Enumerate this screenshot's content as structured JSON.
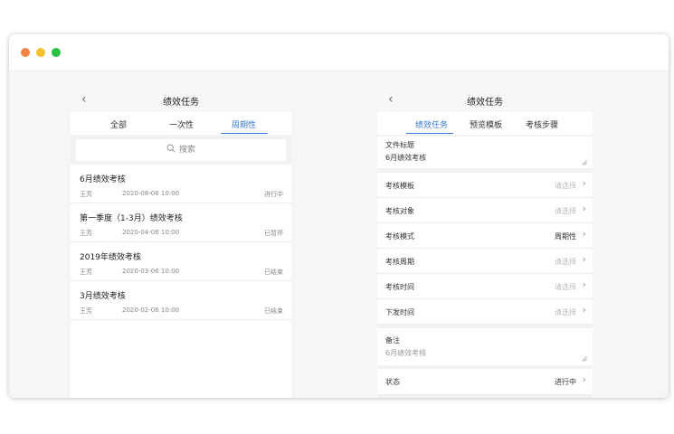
{
  "window": {
    "traffic_lights": [
      "#f0854a",
      "#f5c12e",
      "#27c246"
    ]
  },
  "left_panel": {
    "title": "绩效任务",
    "tabs": [
      "全部",
      "一次性",
      "周期性"
    ],
    "active_tab": 2,
    "search_placeholder": "搜索",
    "items": [
      {
        "title": "6月绩效考核",
        "user": "王芳",
        "date": "2020-08-06  10:00",
        "status": "进行中"
      },
      {
        "title": "第一季度（1-3月）绩效考核",
        "user": "王芳",
        "date": "2020-04-06  10:00",
        "status": "已暂停"
      },
      {
        "title": "2019年绩效考核",
        "user": "王芳",
        "date": "2020-03-06  10:00",
        "status": "已结束"
      },
      {
        "title": "3月绩效考核",
        "user": "王芳",
        "date": "2020-02-06  10:00",
        "status": "已结束"
      }
    ]
  },
  "right_panel": {
    "title": "绩效任务",
    "tabs": [
      "绩效任务",
      "预览模板",
      "考核步骤"
    ],
    "active_tab": 0,
    "file_title": {
      "label": "文件标题",
      "value": "6月绩效考核"
    },
    "rows": [
      {
        "label": "考核模板",
        "value": "请选择"
      },
      {
        "label": "考核对象",
        "value": "请选择"
      },
      {
        "label": "考核模式",
        "value": "周期性"
      },
      {
        "label": "考核周期",
        "value": "请选择"
      },
      {
        "label": "考核时间",
        "value": "请选择"
      },
      {
        "label": "下发时间",
        "value": "请选择"
      }
    ],
    "remark": {
      "label": "备注",
      "value": "6月绩效考核"
    },
    "status": {
      "label": "状态",
      "value": "进行中"
    }
  },
  "colors": {
    "accent": "#3a7bd5"
  }
}
